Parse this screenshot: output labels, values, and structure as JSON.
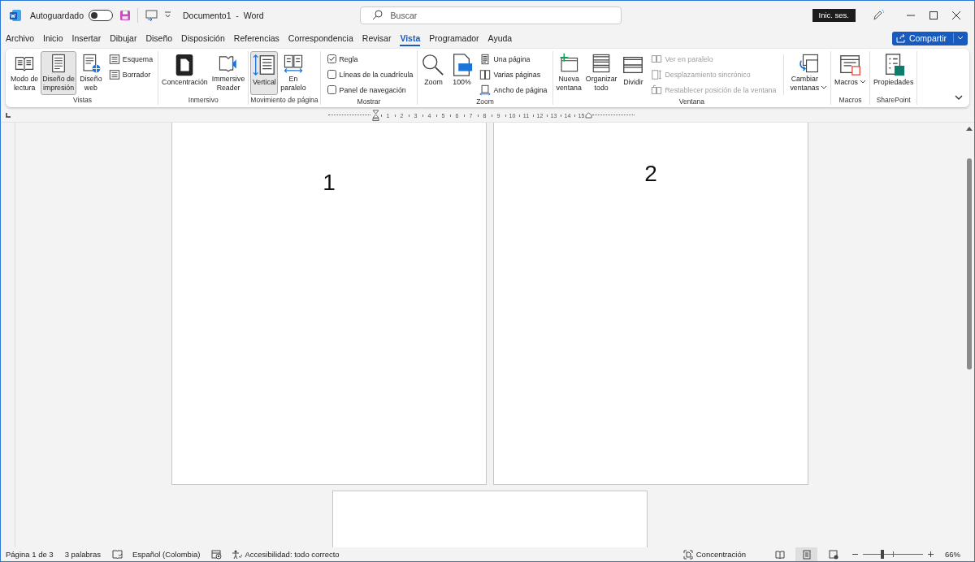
{
  "title_bar": {
    "autosave_label": "Autoguardado",
    "autosave_on": false,
    "document_title": "Documento1  -  Word",
    "search_placeholder": "Buscar",
    "sign_in": "Inic. ses."
  },
  "tabs": [
    {
      "label": "Archivo",
      "selected": false
    },
    {
      "label": "Inicio",
      "selected": false
    },
    {
      "label": "Insertar",
      "selected": false
    },
    {
      "label": "Dibujar",
      "selected": false
    },
    {
      "label": "Diseño",
      "selected": false
    },
    {
      "label": "Disposición",
      "selected": false
    },
    {
      "label": "Referencias",
      "selected": false
    },
    {
      "label": "Correspondencia",
      "selected": false
    },
    {
      "label": "Revisar",
      "selected": false
    },
    {
      "label": "Vista",
      "selected": true
    },
    {
      "label": "Programador",
      "selected": false
    },
    {
      "label": "Ayuda",
      "selected": false
    }
  ],
  "share_button": "Compartir",
  "ribbon": {
    "groups": [
      {
        "label": "Vistas",
        "items": [
          {
            "kind": "large",
            "label": "Modo de\nlectura",
            "selected": false
          },
          {
            "kind": "large",
            "label": "Diseño de\nimpresión",
            "selected": true
          },
          {
            "kind": "large",
            "label": "Diseño\nweb",
            "selected": false
          },
          {
            "kind": "stack",
            "items": [
              {
                "kind": "small",
                "label": "Esquema",
                "disabled": false
              },
              {
                "kind": "small",
                "label": "Borrador",
                "disabled": false
              }
            ]
          }
        ]
      },
      {
        "label": "Inmersivo",
        "items": [
          {
            "kind": "large",
            "label": "Concentración",
            "selected": false
          },
          {
            "kind": "large",
            "label": "Immersive\nReader",
            "selected": false
          }
        ]
      },
      {
        "label": "Movimiento de página",
        "items": [
          {
            "kind": "large",
            "label": "Vertical",
            "selected": true
          },
          {
            "kind": "large",
            "label": "En\nparalelo",
            "selected": false
          }
        ]
      },
      {
        "label": "Mostrar",
        "items": [
          {
            "kind": "stack",
            "items": [
              {
                "kind": "check",
                "label": "Regla",
                "checked": true
              },
              {
                "kind": "check",
                "label": "Líneas de la cuadrícula",
                "checked": false
              },
              {
                "kind": "check",
                "label": "Panel de navegación",
                "checked": false
              }
            ]
          }
        ]
      },
      {
        "label": "Zoom",
        "items": [
          {
            "kind": "large",
            "label": "Zoom",
            "selected": false
          },
          {
            "kind": "large",
            "label": "100%",
            "selected": false
          },
          {
            "kind": "stack",
            "items": [
              {
                "kind": "small",
                "label": "Una página",
                "disabled": false
              },
              {
                "kind": "small",
                "label": "Varias páginas",
                "disabled": false
              },
              {
                "kind": "small",
                "label": "Ancho de página",
                "disabled": false
              }
            ]
          }
        ]
      },
      {
        "label": "Ventana",
        "items": [
          {
            "kind": "large",
            "label": "Nueva\nventana",
            "selected": false
          },
          {
            "kind": "large",
            "label": "Organizar\ntodo",
            "selected": false
          },
          {
            "kind": "large",
            "label": "Dividir",
            "selected": false
          },
          {
            "kind": "stack",
            "items": [
              {
                "kind": "small",
                "label": "Ver en paralelo",
                "disabled": true
              },
              {
                "kind": "small",
                "label": "Desplazamiento sincrónico",
                "disabled": true
              },
              {
                "kind": "small",
                "label": "Restablecer posición de la ventana",
                "disabled": true
              }
            ]
          },
          {
            "kind": "divider"
          },
          {
            "kind": "large",
            "label": "Cambiar\nventanas",
            "selected": false,
            "dropdown": true
          }
        ]
      },
      {
        "label": "Macros",
        "items": [
          {
            "kind": "large",
            "label": "Macros",
            "selected": false,
            "dropdown": true
          }
        ]
      },
      {
        "label": "SharePoint",
        "items": [
          {
            "kind": "large",
            "label": "Propiedades",
            "selected": false
          }
        ]
      }
    ]
  },
  "ruler": {
    "numbers": [
      "1",
      "2",
      "3",
      "4",
      "5",
      "6",
      "7",
      "8",
      "9",
      "10",
      "11",
      "12",
      "13",
      "14",
      "15"
    ]
  },
  "pages": [
    {
      "kind": "text",
      "text": "1"
    },
    {
      "kind": "text",
      "text": "2"
    },
    {
      "kind": "blank"
    }
  ],
  "status_bar": {
    "page": "Página 1 de 3",
    "words": "3 palabras",
    "language": "Español (Colombia)",
    "accessibility": "Accesibilidad: todo correcto",
    "focus": "Concentración",
    "views": [
      {
        "selected": false
      },
      {
        "selected": true
      },
      {
        "selected": false
      }
    ],
    "zoom": {
      "level": 0.32,
      "reading": "66%"
    }
  }
}
